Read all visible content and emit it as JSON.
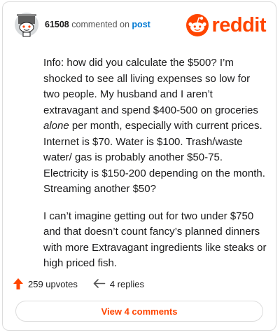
{
  "header": {
    "username": "61508",
    "action_text": "commented on",
    "post_link": "post",
    "brand": "reddit"
  },
  "comment": {
    "paragraph1_before": "Info: how did you calculate the $500? I’m shocked to see all living expenses so low for two people. My husband and I aren’t extravagant and spend $400-500 on groceries ",
    "paragraph1_emphasis": "alone",
    "paragraph1_after": " per month, especially with current prices. Internet is $70. Water is $100. Trash/waste water/ gas is probably another $50-75. Electricity is $150-200 depending on the month. Streaming another $50?",
    "paragraph2": "I can’t imagine getting out for two under $750 and that doesn’t count fancy’s planned dinners with more Extravagant ingredients like steaks or high priced fish."
  },
  "footer": {
    "upvotes": "259 upvotes",
    "replies": "4 replies"
  },
  "view_button": "View 4 comments",
  "colors": {
    "brand": "#ff4500",
    "link": "#0079d3"
  }
}
